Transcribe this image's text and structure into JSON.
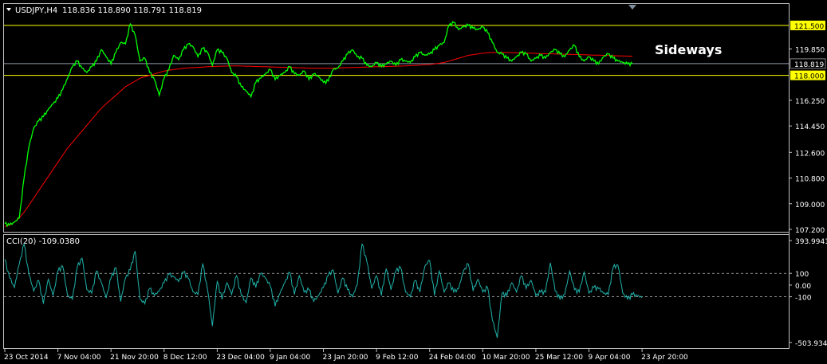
{
  "header": {
    "symbol": "USDJPY,H4",
    "ohlc": "118.836 118.890 118.791 118.819"
  },
  "annotation": "Sideways",
  "indicator": {
    "label": "CCI(20) -109.0380"
  },
  "colors": {
    "background": "#000000",
    "price": "#00ff00",
    "moving_average": "#ff0000",
    "cci": "#20b2aa",
    "level_lines": "#ffff00",
    "axis": "#c0c0c0"
  },
  "chart_data": [
    {
      "type": "line",
      "name": "price",
      "ylim": [
        107.2,
        122.5
      ],
      "ticks": [
        "121.500",
        "119.850",
        "118.000",
        "116.250",
        "114.450",
        "112.600",
        "110.800",
        "109.000",
        "107.200"
      ],
      "tick_values": [
        121.5,
        119.85,
        118.0,
        116.25,
        114.45,
        112.6,
        110.8,
        109.0,
        107.2
      ],
      "highlight_levels": [
        {
          "label": "121.500",
          "value": 121.5
        },
        {
          "label": "118.000",
          "value": 118.0
        }
      ],
      "current_price": {
        "label": "118.819",
        "value": 118.819
      },
      "x_labels": [
        "23 Oct 2014",
        "7 Nov 04:00",
        "21 Nov 20:00",
        "8 Dec 12:00",
        "23 Dec 04:00",
        "9 Jan 04:00",
        "23 Jan 20:00",
        "9 Feb 12:00",
        "24 Feb 04:00",
        "10 Mar 20:00",
        "25 Mar 12:00",
        "9 Apr 04:00",
        "23 Apr 20:00"
      ],
      "x_index": [
        0,
        11,
        22,
        33,
        44,
        55,
        66,
        77,
        88,
        99,
        110,
        121,
        132
      ],
      "series": [
        {
          "name": "USDJPY",
          "values": [
            107.6,
            107.5,
            107.7,
            108.0,
            110.8,
            113.0,
            114.3,
            114.8,
            115.1,
            115.6,
            116.0,
            116.4,
            117.0,
            117.8,
            118.6,
            119.0,
            118.5,
            118.2,
            118.6,
            119.0,
            119.8,
            119.3,
            118.8,
            119.6,
            120.3,
            120.2,
            121.6,
            120.8,
            119.0,
            119.2,
            118.2,
            117.7,
            116.6,
            117.8,
            118.4,
            119.4,
            119.1,
            119.8,
            120.2,
            120.0,
            119.3,
            119.9,
            119.6,
            118.7,
            119.8,
            119.6,
            119.2,
            118.2,
            117.9,
            117.2,
            116.9,
            116.5,
            117.5,
            117.8,
            118.1,
            118.4,
            117.7,
            118.0,
            118.2,
            118.6,
            118.1,
            118.0,
            118.3,
            117.7,
            118.1,
            117.9,
            117.5,
            117.6,
            118.4,
            118.5,
            119.0,
            119.5,
            119.8,
            119.3,
            119.2,
            118.7,
            118.6,
            118.9,
            118.6,
            118.8,
            119.0,
            118.7,
            119.1,
            119.0,
            118.9,
            119.3,
            119.6,
            119.4,
            119.5,
            119.8,
            120.1,
            120.3,
            121.5,
            121.7,
            121.2,
            121.4,
            121.5,
            121.3,
            121.2,
            121.4,
            121.0,
            120.3,
            119.6,
            119.5,
            119.2,
            119.0,
            119.3,
            119.6,
            119.5,
            119.0,
            119.2,
            119.4,
            119.2,
            119.6,
            119.8,
            119.5,
            119.3,
            119.8,
            120.1,
            119.3,
            119.0,
            119.3,
            119.0,
            118.8,
            119.3,
            119.5,
            119.2,
            119.0,
            118.9,
            118.8,
            118.8
          ]
        },
        {
          "name": "MA",
          "values": [
            107.4,
            107.5,
            107.7,
            108.0,
            108.4,
            108.9,
            109.4,
            109.9,
            110.4,
            110.9,
            111.4,
            111.9,
            112.4,
            112.9,
            113.3,
            113.7,
            114.1,
            114.5,
            114.9,
            115.3,
            115.7,
            116.0,
            116.3,
            116.6,
            116.9,
            117.2,
            117.4,
            117.6,
            117.8,
            117.9,
            118.0,
            118.1,
            118.2,
            118.3,
            118.35,
            118.4,
            118.45,
            118.5,
            118.52,
            118.54,
            118.56,
            118.58,
            118.6,
            118.62,
            118.63,
            118.64,
            118.65,
            118.66,
            118.66,
            118.65,
            118.64,
            118.63,
            118.62,
            118.61,
            118.6,
            118.59,
            118.58,
            118.57,
            118.56,
            118.55,
            118.54,
            118.53,
            118.52,
            118.51,
            118.5,
            118.5,
            118.5,
            118.5,
            118.51,
            118.52,
            118.53,
            118.54,
            118.55,
            118.56,
            118.57,
            118.58,
            118.59,
            118.6,
            118.61,
            118.62,
            118.63,
            118.64,
            118.65,
            118.66,
            118.68,
            118.7,
            118.72,
            118.74,
            118.76,
            118.8,
            118.85,
            118.9,
            119.0,
            119.1,
            119.2,
            119.3,
            119.4,
            119.45,
            119.5,
            119.55,
            119.58,
            119.6,
            119.6,
            119.6,
            119.6,
            119.59,
            119.58,
            119.57,
            119.56,
            119.55,
            119.54,
            119.53,
            119.52,
            119.51,
            119.5,
            119.49,
            119.48,
            119.47,
            119.46,
            119.45,
            119.44,
            119.43,
            119.42,
            119.41,
            119.4,
            119.39,
            119.38,
            119.37,
            119.36,
            119.35,
            119.34
          ]
        }
      ]
    },
    {
      "type": "line",
      "name": "CCI(20)",
      "ylim": [
        -503.9344,
        393.9941
      ],
      "ticks": [
        "393.9941",
        "100",
        "0.00",
        "-100",
        "-503.9344"
      ],
      "tick_values": [
        393.9941,
        100,
        0,
        -100,
        -503.9344
      ],
      "levels": [
        100,
        -100
      ],
      "series": [
        {
          "name": "CCI(20)",
          "values": [
            220,
            60,
            -20,
            180,
            350,
            90,
            -50,
            40,
            -160,
            50,
            -90,
            120,
            160,
            -90,
            -120,
            150,
            230,
            -40,
            -70,
            120,
            20,
            -110,
            60,
            150,
            -140,
            60,
            130,
            290,
            -120,
            -160,
            -30,
            -90,
            -50,
            20,
            90,
            70,
            30,
            110,
            60,
            -60,
            -80,
            180,
            -40,
            -350,
            30,
            -120,
            20,
            -80,
            80,
            -90,
            -150,
            60,
            -20,
            100,
            60,
            -10,
            -180,
            -70,
            20,
            110,
            -80,
            80,
            -60,
            -40,
            -140,
            -90,
            -20,
            80,
            130,
            -70,
            60,
            -40,
            -100,
            0,
            350,
            200,
            -30,
            80,
            -90,
            140,
            -40,
            120,
            150,
            -60,
            -100,
            40,
            -60,
            160,
            210,
            -90,
            120,
            -60,
            20,
            -60,
            -30,
            120,
            180,
            -50,
            50,
            -60,
            -20,
            -300,
            -450,
            -70,
            -90,
            20,
            -60,
            80,
            -30,
            40,
            -90,
            -60,
            -60,
            190,
            -50,
            -120,
            -80,
            120,
            -40,
            -60,
            110,
            -70,
            -20,
            -30,
            -70,
            -80,
            150,
            170,
            -70,
            -120,
            -80,
            -90,
            -109
          ]
        }
      ]
    }
  ]
}
